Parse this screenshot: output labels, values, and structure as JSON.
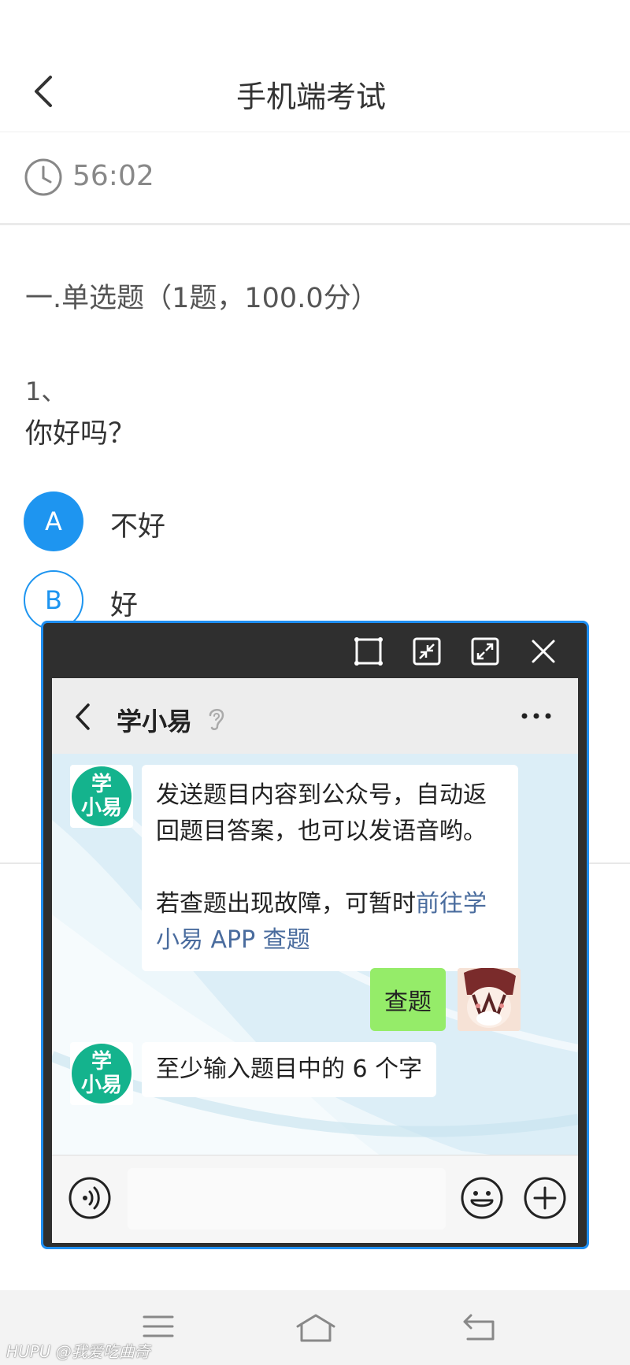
{
  "header": {
    "title": "手机端考试"
  },
  "timer": {
    "value": "56:02"
  },
  "section": {
    "title": "一.单选题（1题，100.0分）"
  },
  "question": {
    "number": "1、",
    "text": "你好吗？",
    "options": [
      {
        "letter": "A",
        "text": "不好",
        "selected": true
      },
      {
        "letter": "B",
        "text": "好",
        "selected": false
      }
    ]
  },
  "chat": {
    "title": "学小易",
    "avatar_text": [
      "学",
      "小易"
    ],
    "messages": [
      {
        "from": "bot",
        "text": "发送题目内容到公众号，自动返回题目答案，也可以发语音哟。",
        "text2": "若查题出现故障，可暂时",
        "link": "前往学小易 APP 查题"
      },
      {
        "from": "me",
        "text": "查题"
      },
      {
        "from": "bot",
        "text": "至少输入题目中的 6 个字"
      }
    ]
  },
  "watermark": {
    "brand": "HUPU",
    "handle": "@我爱吃曲奇"
  },
  "colors": {
    "accent": "#1e95f0",
    "bot_avatar": "#14b38d",
    "my_bubble": "#95ec69",
    "link": "#4a6c9e"
  }
}
